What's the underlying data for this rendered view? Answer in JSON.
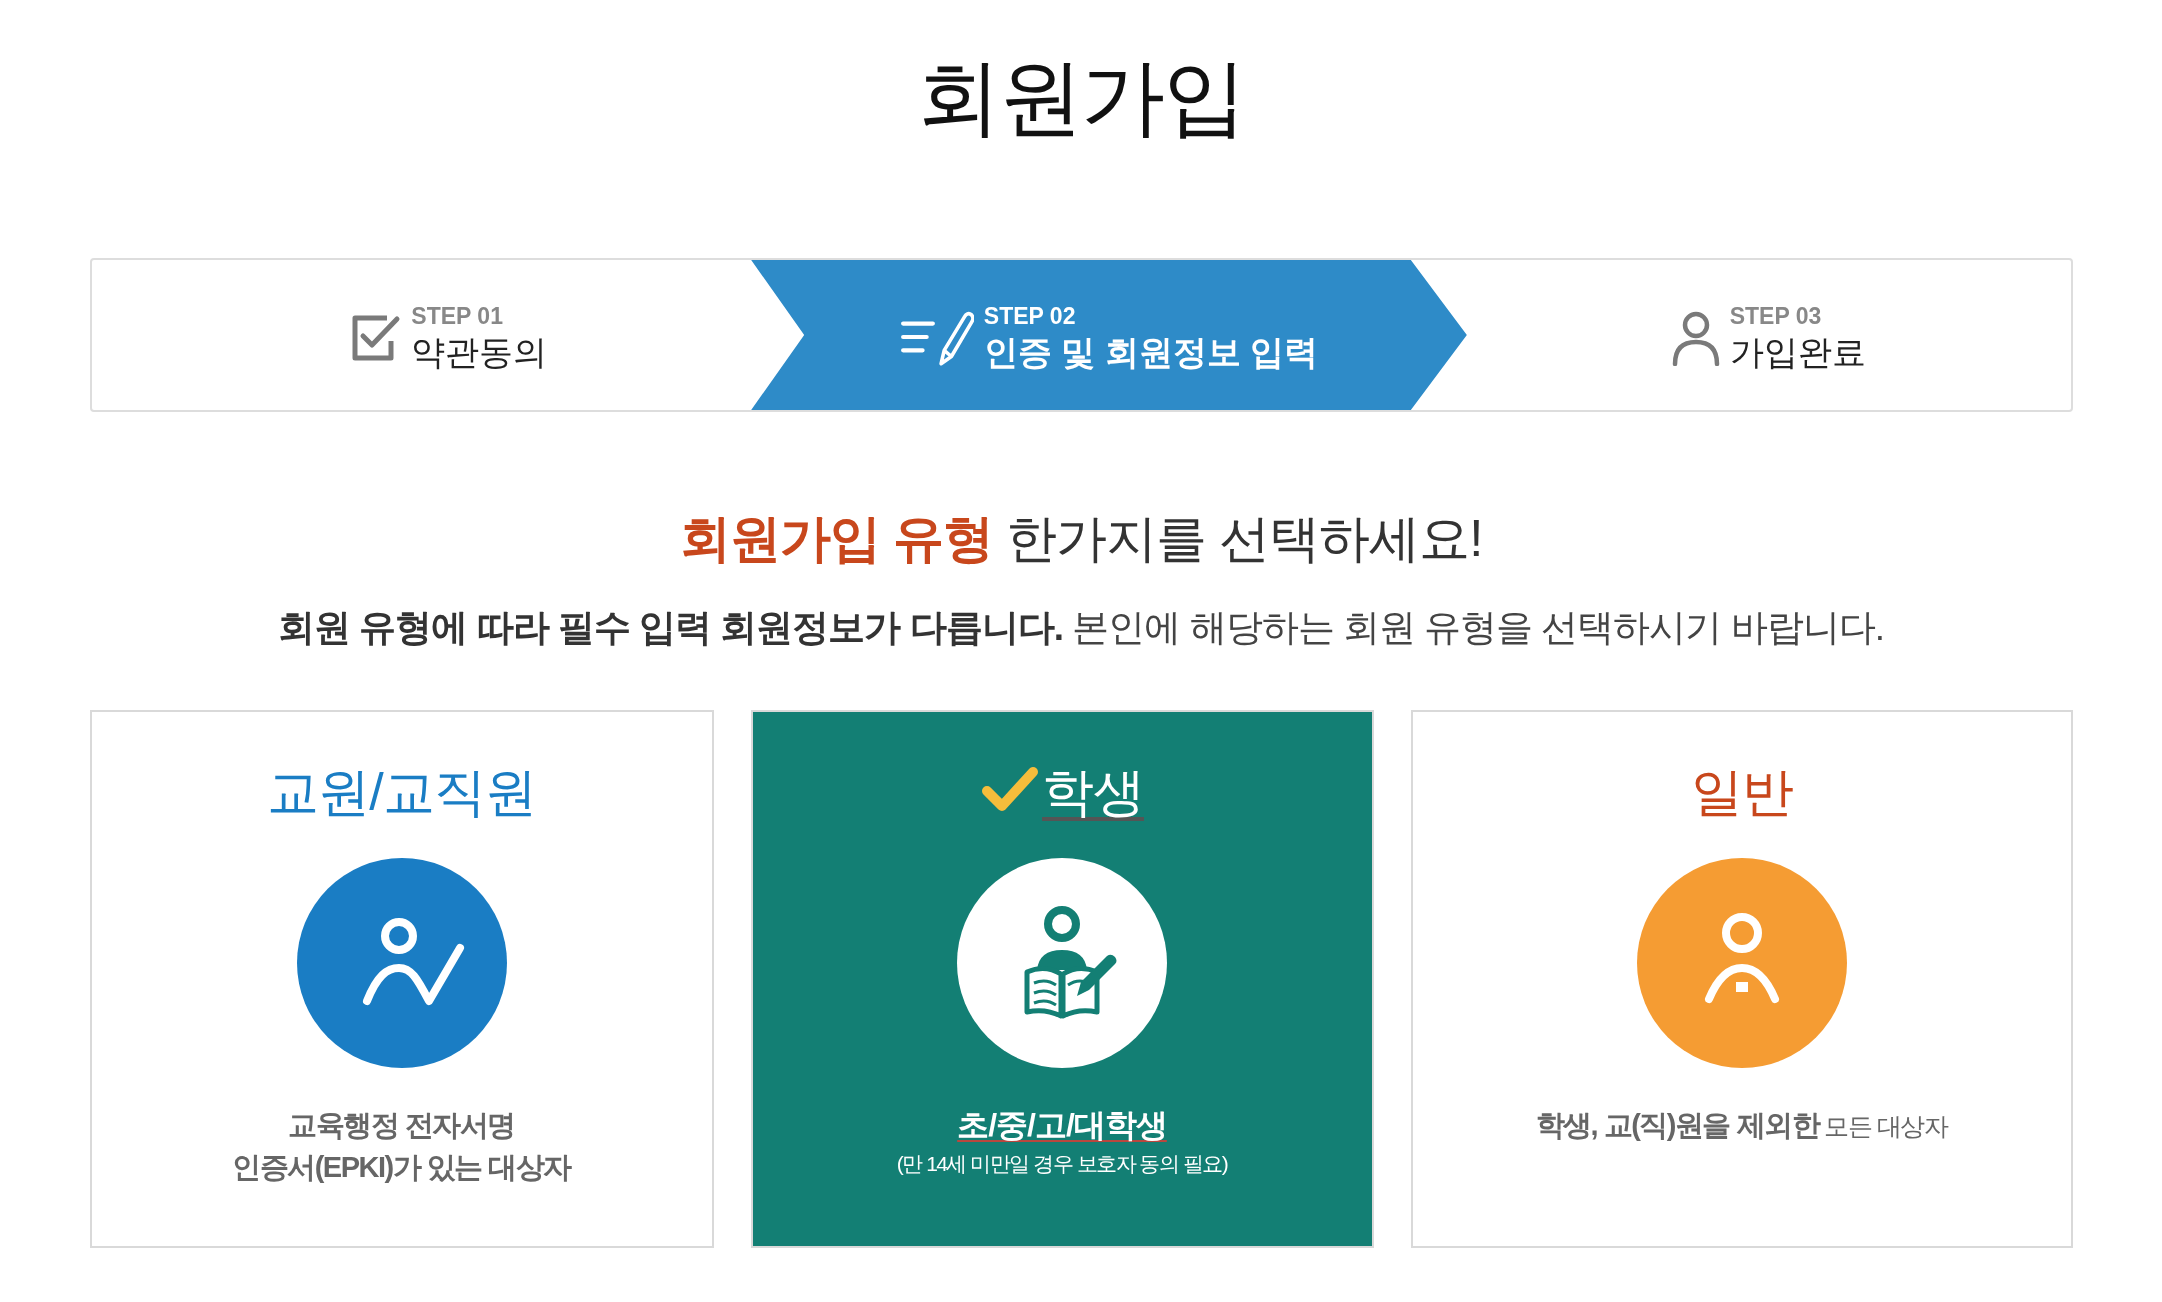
{
  "page": {
    "title": "회원가입"
  },
  "steps": [
    {
      "kind": "terms",
      "step": "STEP 01",
      "label": "약관동의",
      "selected": false
    },
    {
      "kind": "info",
      "step": "STEP 02",
      "label": "인증 및 회원정보 입력",
      "selected": true
    },
    {
      "kind": "complete",
      "step": "STEP 03",
      "label": "가입완료",
      "selected": false
    }
  ],
  "intro": {
    "heading": "**회원가입 유형** 한가지를 선택하세요!",
    "text": "**회원 유형에 따라 필수 입력 회원정보가 다릅니다.** 본인에 해당하는 회원 유형을 선택하시기 바랍니다."
  },
  "member_types": [
    {
      "kind": "teacher",
      "title": "교원/교직원",
      "color": "#1a7dc4",
      "selected": false,
      "description": [
        "교육행정 전자서명",
        "인증서(EPKI)가 있는 대상자"
      ]
    },
    {
      "kind": "student",
      "title": "학생",
      "color": "#137f74",
      "selected": true,
      "description": [
        "초/중/고/대학생"
      ],
      "note": "(만 14세 미만일 경우 보호자 동의 필요)"
    },
    {
      "kind": "general",
      "title": "일반",
      "color": "#f59c33",
      "selected": false,
      "description": [
        "**학생, 교(직)원을 제외한** 모든 대상자"
      ]
    }
  ]
}
